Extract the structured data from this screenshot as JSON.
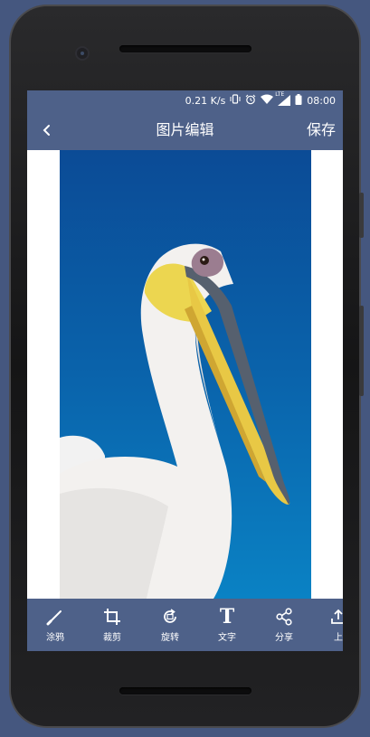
{
  "status_bar": {
    "network_speed": "0.21 K/s",
    "icons": [
      "vibrate-icon",
      "alarm-icon",
      "wifi-icon",
      "lte-signal-icon",
      "battery-icon"
    ],
    "lte": "LTE",
    "time": "08:00"
  },
  "header": {
    "back_icon": "chevron-left-icon",
    "title": "图片编辑",
    "save_label": "保存"
  },
  "toolbar": {
    "items": [
      {
        "label": "涂鸦",
        "icon": "brush-icon"
      },
      {
        "label": "裁剪",
        "icon": "crop-icon"
      },
      {
        "label": "旋转",
        "icon": "rotate-icon"
      },
      {
        "label": "文字",
        "icon": "text-icon",
        "glyph": "T"
      },
      {
        "label": "分享",
        "icon": "share-icon"
      },
      {
        "label": "上",
        "icon": "upload-icon"
      }
    ]
  },
  "colors": {
    "background": "#45577f",
    "bars": "#4e6189",
    "text": "#ffffff",
    "canvas": "#ffffff"
  }
}
